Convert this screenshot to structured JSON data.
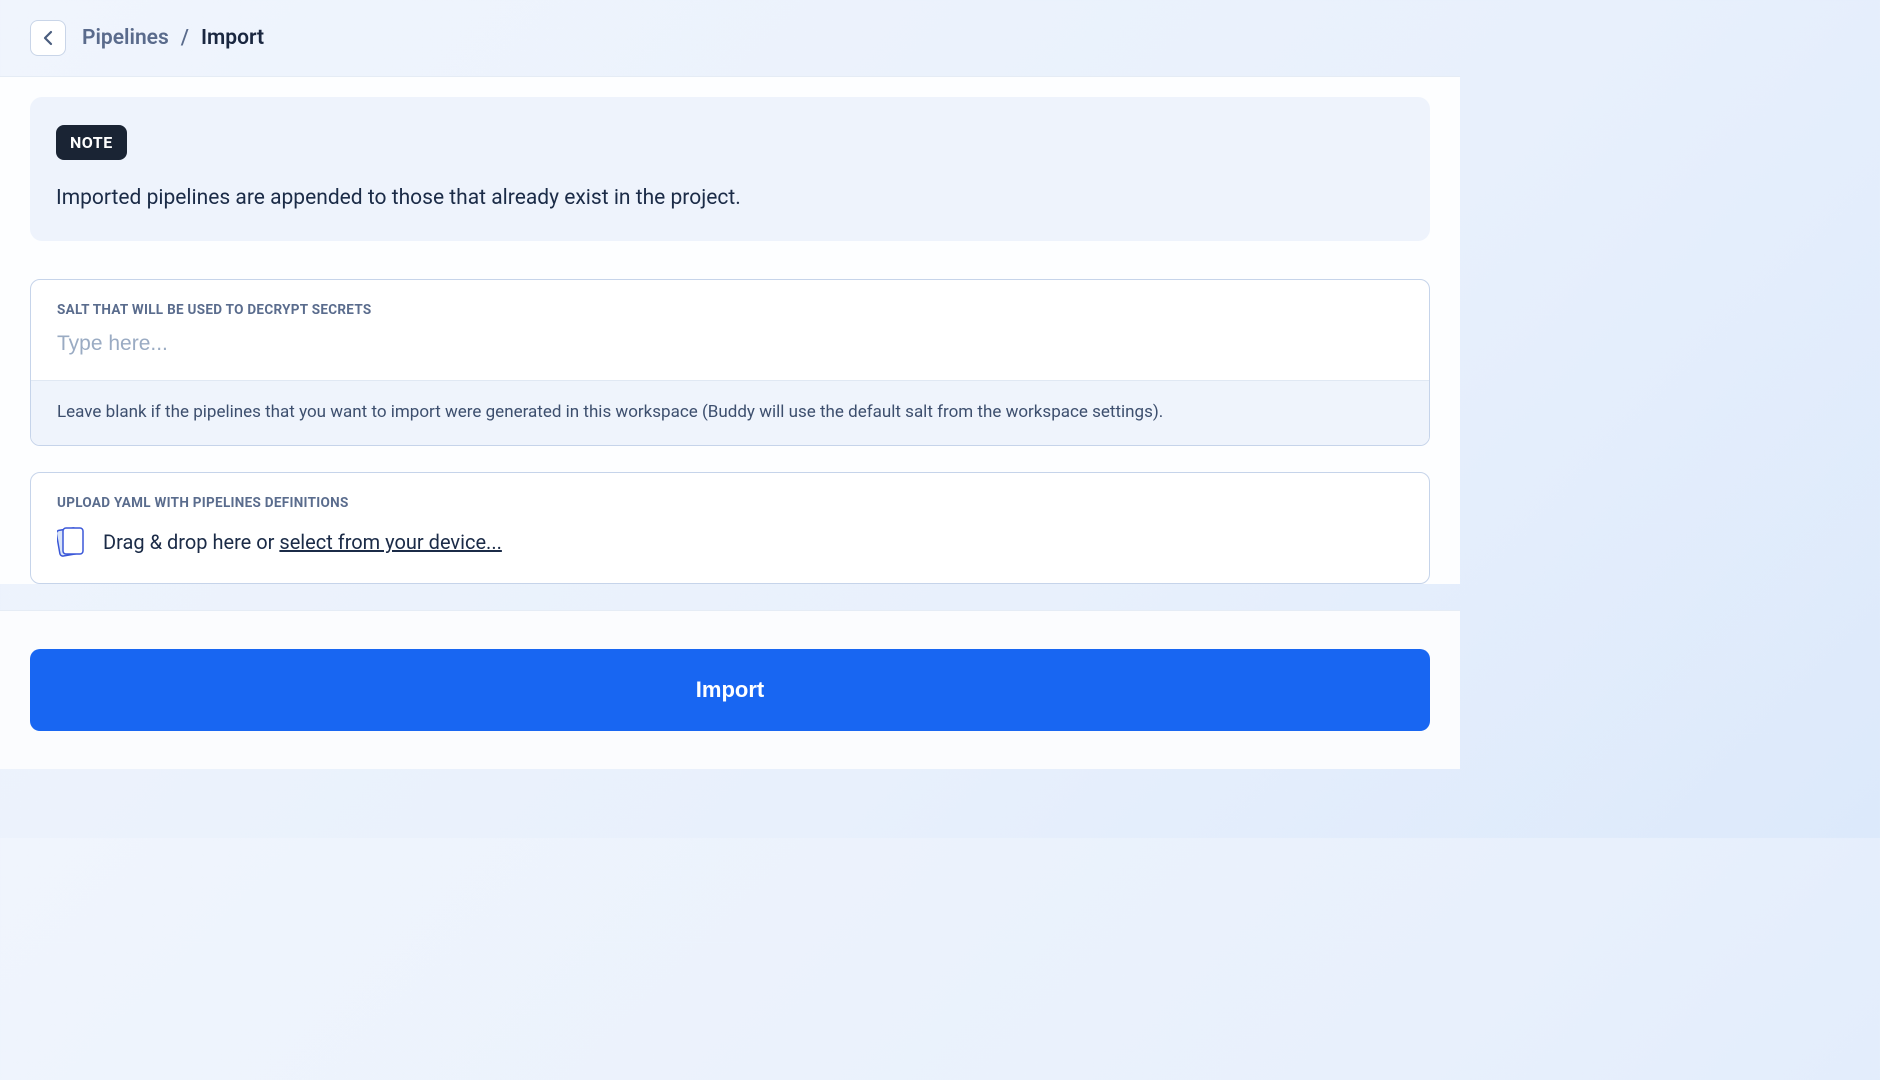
{
  "breadcrumb": {
    "parent": "Pipelines",
    "separator": "/",
    "current": "Import"
  },
  "note": {
    "badge": "NOTE",
    "text": "Imported pipelines are appended to those that already exist in the project."
  },
  "salt": {
    "label": "SALT THAT WILL BE USED TO DECRYPT SECRETS",
    "placeholder": "Type here...",
    "hint": "Leave blank if the pipelines that you want to import were generated in this workspace (Buddy will use the default salt from the workspace settings)."
  },
  "upload": {
    "label": "UPLOAD YAML WITH PIPELINES DEFINITIONS",
    "text_prefix": "Drag & drop here or ",
    "link_text": "select from your device..."
  },
  "footer": {
    "import_button": "Import"
  }
}
